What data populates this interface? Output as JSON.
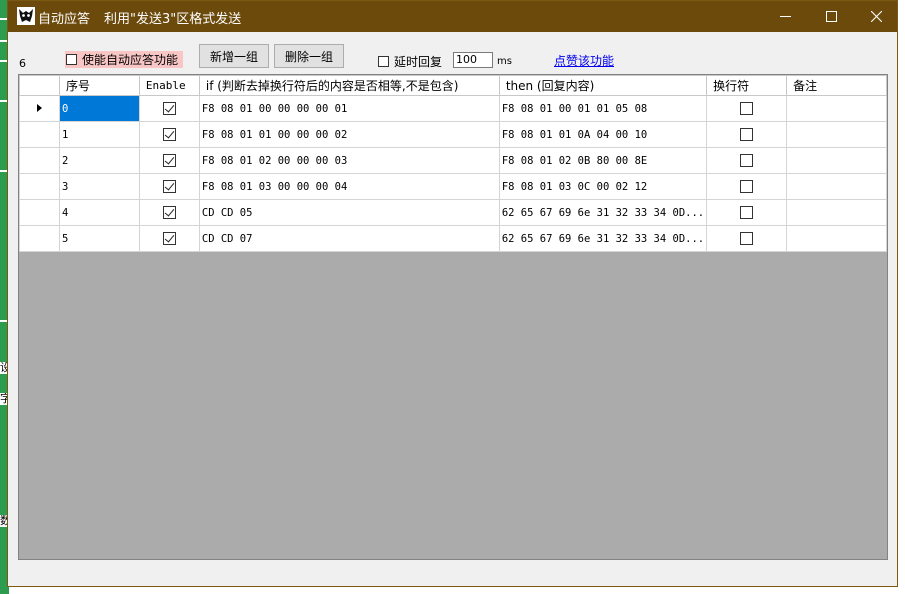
{
  "window": {
    "title": "自动应答",
    "subtitle": "利用\"发送3\"区格式发送"
  },
  "toolbar": {
    "row_count": "6",
    "enable_auto_label": "使能自动应答功能",
    "add_button": "新增一组",
    "delete_button": "删除一组",
    "delay_label": "延时回复",
    "delay_value": "100",
    "delay_unit": "ms",
    "like_link": "点赞该功能"
  },
  "grid": {
    "columns": [
      "序号",
      "Enable",
      "if (判断去掉换行符后的内容是否相等,不是包含)",
      "then (回复内容)",
      "换行符",
      "备注"
    ],
    "rows": [
      {
        "index": "0",
        "enabled": true,
        "if": "F8 08 01 00 00 00 00 01",
        "then": "F8 08 01 00 01 01 05 08",
        "newline": false,
        "note": ""
      },
      {
        "index": "1",
        "enabled": true,
        "if": "F8 08 01 01 00 00 00 02",
        "then": "F8 08 01 01 0A 04 00 10",
        "newline": false,
        "note": ""
      },
      {
        "index": "2",
        "enabled": true,
        "if": "F8 08 01 02 00 00 00 03",
        "then": "F8 08 01 02 0B 80 00 8E",
        "newline": false,
        "note": ""
      },
      {
        "index": "3",
        "enabled": true,
        "if": "F8 08 01 03 00 00 00 04",
        "then": "F8 08 01 03 0C 00 02 12",
        "newline": false,
        "note": ""
      },
      {
        "index": "4",
        "enabled": true,
        "if": "CD CD 05",
        "then": "62 65 67 69 6e 31 32 33 34 0D...",
        "newline": false,
        "note": ""
      },
      {
        "index": "5",
        "enabled": true,
        "if": "CD CD 07",
        "then": "62 65 67 69 6e 31 32 33 34 0D...",
        "newline": false,
        "note": ""
      }
    ]
  },
  "background_app": {
    "glyphs": [
      "设",
      "字",
      "数"
    ]
  }
}
